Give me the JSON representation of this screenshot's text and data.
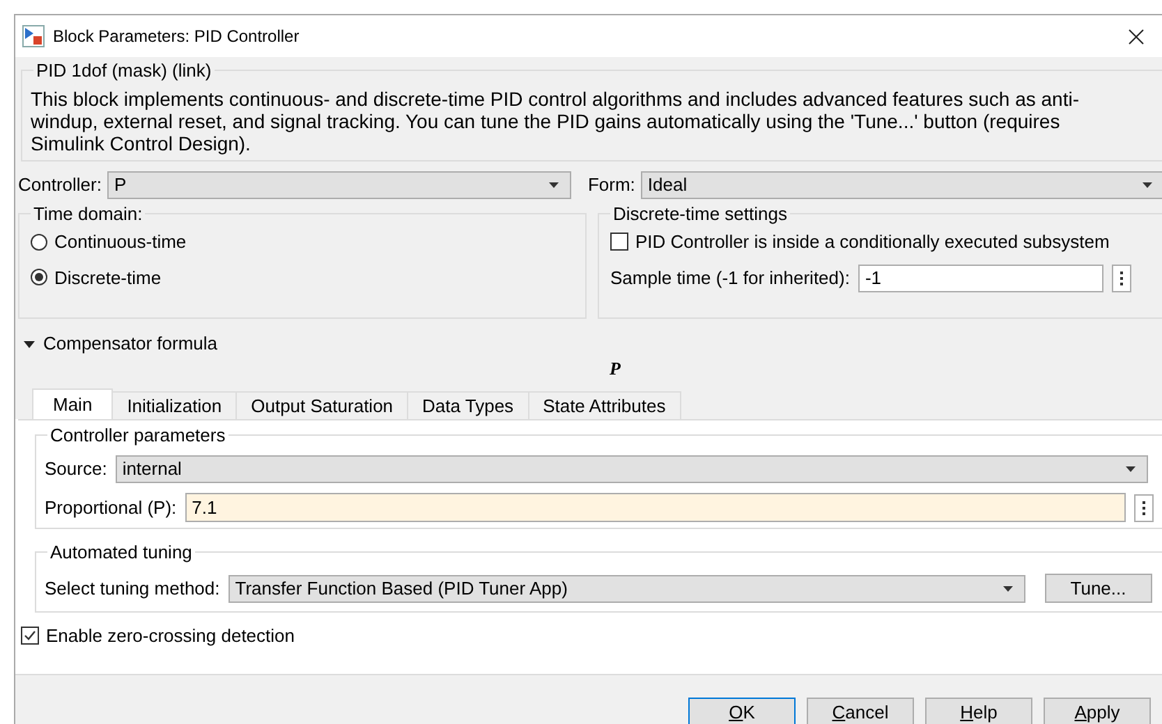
{
  "window": {
    "title": "Block Parameters: PID Controller"
  },
  "mask": {
    "title": "PID 1dof (mask) (link)",
    "description": "This block implements continuous- and discrete-time PID control algorithms and includes advanced features such as anti-windup, external reset, and signal tracking. You can tune the PID gains automatically using the 'Tune...' button (requires Simulink Control Design)."
  },
  "controller": {
    "label": "Controller:",
    "value": "P"
  },
  "form": {
    "label": "Form:",
    "value": "Ideal"
  },
  "time_domain": {
    "title": "Time domain:",
    "options": [
      {
        "label": "Continuous-time",
        "selected": false
      },
      {
        "label": "Discrete-time",
        "selected": true
      }
    ]
  },
  "discrete_settings": {
    "title": "Discrete-time settings",
    "checkbox": {
      "label": "PID Controller is inside a conditionally executed subsystem",
      "checked": false
    },
    "sample_time": {
      "label": "Sample time (-1 for inherited):",
      "value": "-1"
    }
  },
  "compensator": {
    "label": "Compensator formula",
    "expanded": true,
    "formula": "P"
  },
  "tabs": [
    {
      "label": "Main",
      "selected": true
    },
    {
      "label": "Initialization",
      "selected": false
    },
    {
      "label": "Output Saturation",
      "selected": false
    },
    {
      "label": "Data Types",
      "selected": false
    },
    {
      "label": "State Attributes",
      "selected": false
    }
  ],
  "controller_parameters": {
    "title": "Controller parameters",
    "source": {
      "label": "Source:",
      "value": "internal"
    },
    "proportional": {
      "label": "Proportional (P):",
      "value": "7.1"
    }
  },
  "automated_tuning": {
    "title": "Automated tuning",
    "method": {
      "label": "Select tuning method:",
      "value": "Transfer Function Based (PID Tuner App)"
    },
    "tune_button": "Tune..."
  },
  "zero_crossing": {
    "label": "Enable zero-crossing detection",
    "checked": true
  },
  "buttons": [
    {
      "label": "OK",
      "default": true
    },
    {
      "label": "Cancel",
      "default": false
    },
    {
      "label": "Help",
      "default": false
    },
    {
      "label": "Apply",
      "default": false
    }
  ]
}
